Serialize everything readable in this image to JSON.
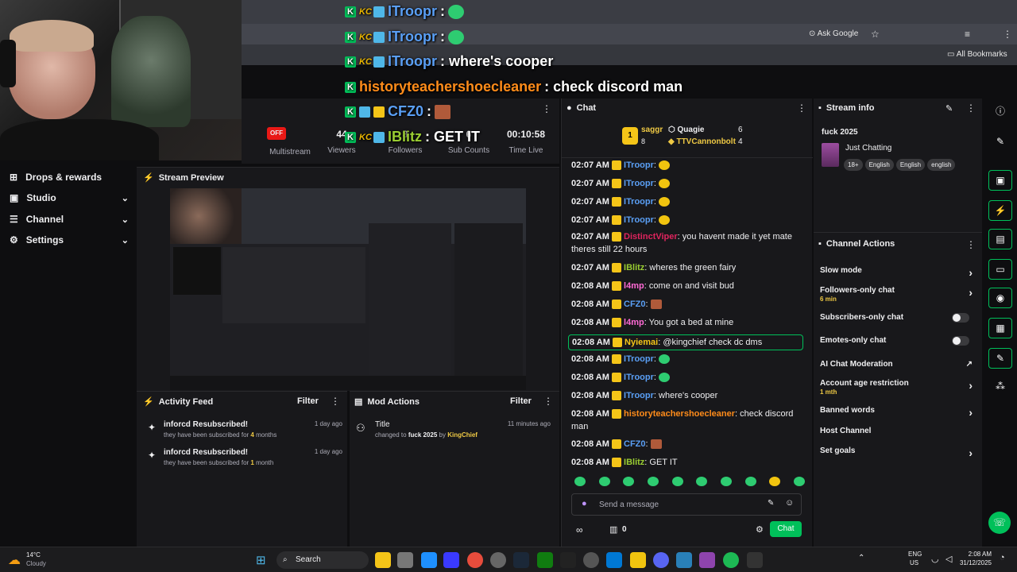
{
  "browser": {
    "ask_google": "Ask Google",
    "all_bookmarks": "All Bookmarks"
  },
  "overlay": {
    "lines": [
      {
        "user": "ITroopr",
        "text": ":"
      },
      {
        "user": "ITroopr",
        "text": ":"
      },
      {
        "user": "ITroopr",
        "text": ": where's cooper"
      },
      {
        "user": "historyteachershoecleaner",
        "text": ": check discord man"
      },
      {
        "user": "CFZ0",
        "text": ":"
      },
      {
        "user": "IBlitz",
        "text": ": GET IT"
      }
    ]
  },
  "sidebar": {
    "items": [
      {
        "label": "Drops & rewards",
        "icon": "drops-icon"
      },
      {
        "label": "Studio",
        "icon": "studio-icon"
      },
      {
        "label": "Channel",
        "icon": "channel-icon"
      },
      {
        "label": "Settings",
        "icon": "gear-icon"
      }
    ]
  },
  "stats": {
    "off": "OFF",
    "multistream": "Multistream",
    "viewers_val": "44",
    "viewers": "Viewers",
    "followers_val": "8",
    "followers": "Followers",
    "subs_val": "6",
    "subs": "Sub Counts",
    "time_val": "00:10:58",
    "time": "Time Live"
  },
  "preview": {
    "title": "Stream Preview"
  },
  "activity": {
    "title": "Activity Feed",
    "filter": "Filter",
    "items": [
      {
        "name": "inforcd Resubscribed!",
        "pre": "they have been subscribed for ",
        "num": "4",
        "post": " months",
        "date": "1 day ago"
      },
      {
        "name": "inforcd Resubscribed!",
        "pre": "they have been subscribed for ",
        "num": "1",
        "post": " month",
        "date": "1 day ago"
      }
    ]
  },
  "modactions": {
    "title": "Mod Actions",
    "filter": "Filter",
    "item": {
      "title": "Title",
      "pre": "changed to ",
      "value": "fuck 2025",
      "by": " by ",
      "who": "KingChief",
      "date": "11 minutes ago"
    }
  },
  "chat": {
    "title": "Chat",
    "leaders": {
      "rank": "1",
      "first": "saggr",
      "first_count": "8",
      "second": "Quagie",
      "second_count": "6",
      "third": "TTVCannonbolt",
      "third_count": "4"
    },
    "messages": [
      {
        "time": "02:07 AM",
        "user": "ITroopr",
        "color": "#5a9ff5",
        "text": ":"
      },
      {
        "time": "02:07 AM",
        "user": "ITroopr",
        "color": "#5a9ff5",
        "text": ":"
      },
      {
        "time": "02:07 AM",
        "user": "ITroopr",
        "color": "#5a9ff5",
        "text": ":"
      },
      {
        "time": "02:07 AM",
        "user": "ITroopr",
        "color": "#5a9ff5",
        "text": ":"
      },
      {
        "time": "02:07 AM",
        "user": "DistinctViper",
        "color": "#e0245e",
        "text": ": you havent made it yet mate theres still 22 hours"
      },
      {
        "time": "02:07 AM",
        "user": "IBlitz",
        "color": "#9acd32",
        "text": ": wheres the green fairy"
      },
      {
        "time": "02:08 AM",
        "user": "l4mp",
        "color": "#ff6ad5",
        "text": ": come on and visit bud"
      },
      {
        "time": "02:08 AM",
        "user": "CFZ0",
        "color": "#5a9ff5",
        "text": ":"
      },
      {
        "time": "02:08 AM",
        "user": "l4mp",
        "color": "#ff6ad5",
        "text": ": You got a bed at mine"
      },
      {
        "time": "02:08 AM",
        "user": "Nyiemai",
        "color": "#f5c518",
        "text": ": @kingchief check dc dms"
      },
      {
        "time": "02:08 AM",
        "user": "ITroopr",
        "color": "#5a9ff5",
        "text": ":"
      },
      {
        "time": "02:08 AM",
        "user": "ITroopr",
        "color": "#5a9ff5",
        "text": ":"
      },
      {
        "time": "02:08 AM",
        "user": "ITroopr",
        "color": "#5a9ff5",
        "text": ": where's cooper"
      },
      {
        "time": "02:08 AM",
        "user": "historyteachershoecleaner",
        "color": "#ff8c1a",
        "text": ": check discord man"
      },
      {
        "time": "02:08 AM",
        "user": "CFZ0",
        "color": "#5a9ff5",
        "text": ":"
      },
      {
        "time": "02:08 AM",
        "user": "IBlitz",
        "color": "#9acd32",
        "text": ": GET IT"
      }
    ],
    "input_placeholder": "Send a message",
    "points": "0",
    "chat_button": "Chat"
  },
  "streaminfo": {
    "title": "Stream info",
    "stream_title": "fuck 2025",
    "category": "Just Chatting",
    "tags": [
      "18+",
      "English",
      "English",
      "english"
    ]
  },
  "channelactions": {
    "title": "Channel Actions",
    "items": [
      {
        "label": "Slow mode",
        "sub": ""
      },
      {
        "label": "Followers-only chat",
        "sub": "6 min"
      },
      {
        "label": "Subscribers-only chat",
        "sub": ""
      },
      {
        "label": "Emotes-only chat",
        "sub": ""
      },
      {
        "label": "AI Chat Moderation",
        "sub": ""
      },
      {
        "label": "Account age restriction",
        "sub": "1 mth"
      },
      {
        "label": "Banned words",
        "sub": ""
      },
      {
        "label": "Host Channel",
        "sub": ""
      },
      {
        "label": "Set goals",
        "sub": ""
      }
    ]
  },
  "taskbar": {
    "temp": "14°C",
    "weather": "Cloudy",
    "search": "Search",
    "lang1": "ENG",
    "lang2": "US",
    "time": "2:08 AM",
    "date": "31/12/2025"
  },
  "colors": {
    "accent": "#00c05a",
    "twitch_purple": "#9146ff",
    "bg": "#0e0e10",
    "panel": "#18181b"
  }
}
